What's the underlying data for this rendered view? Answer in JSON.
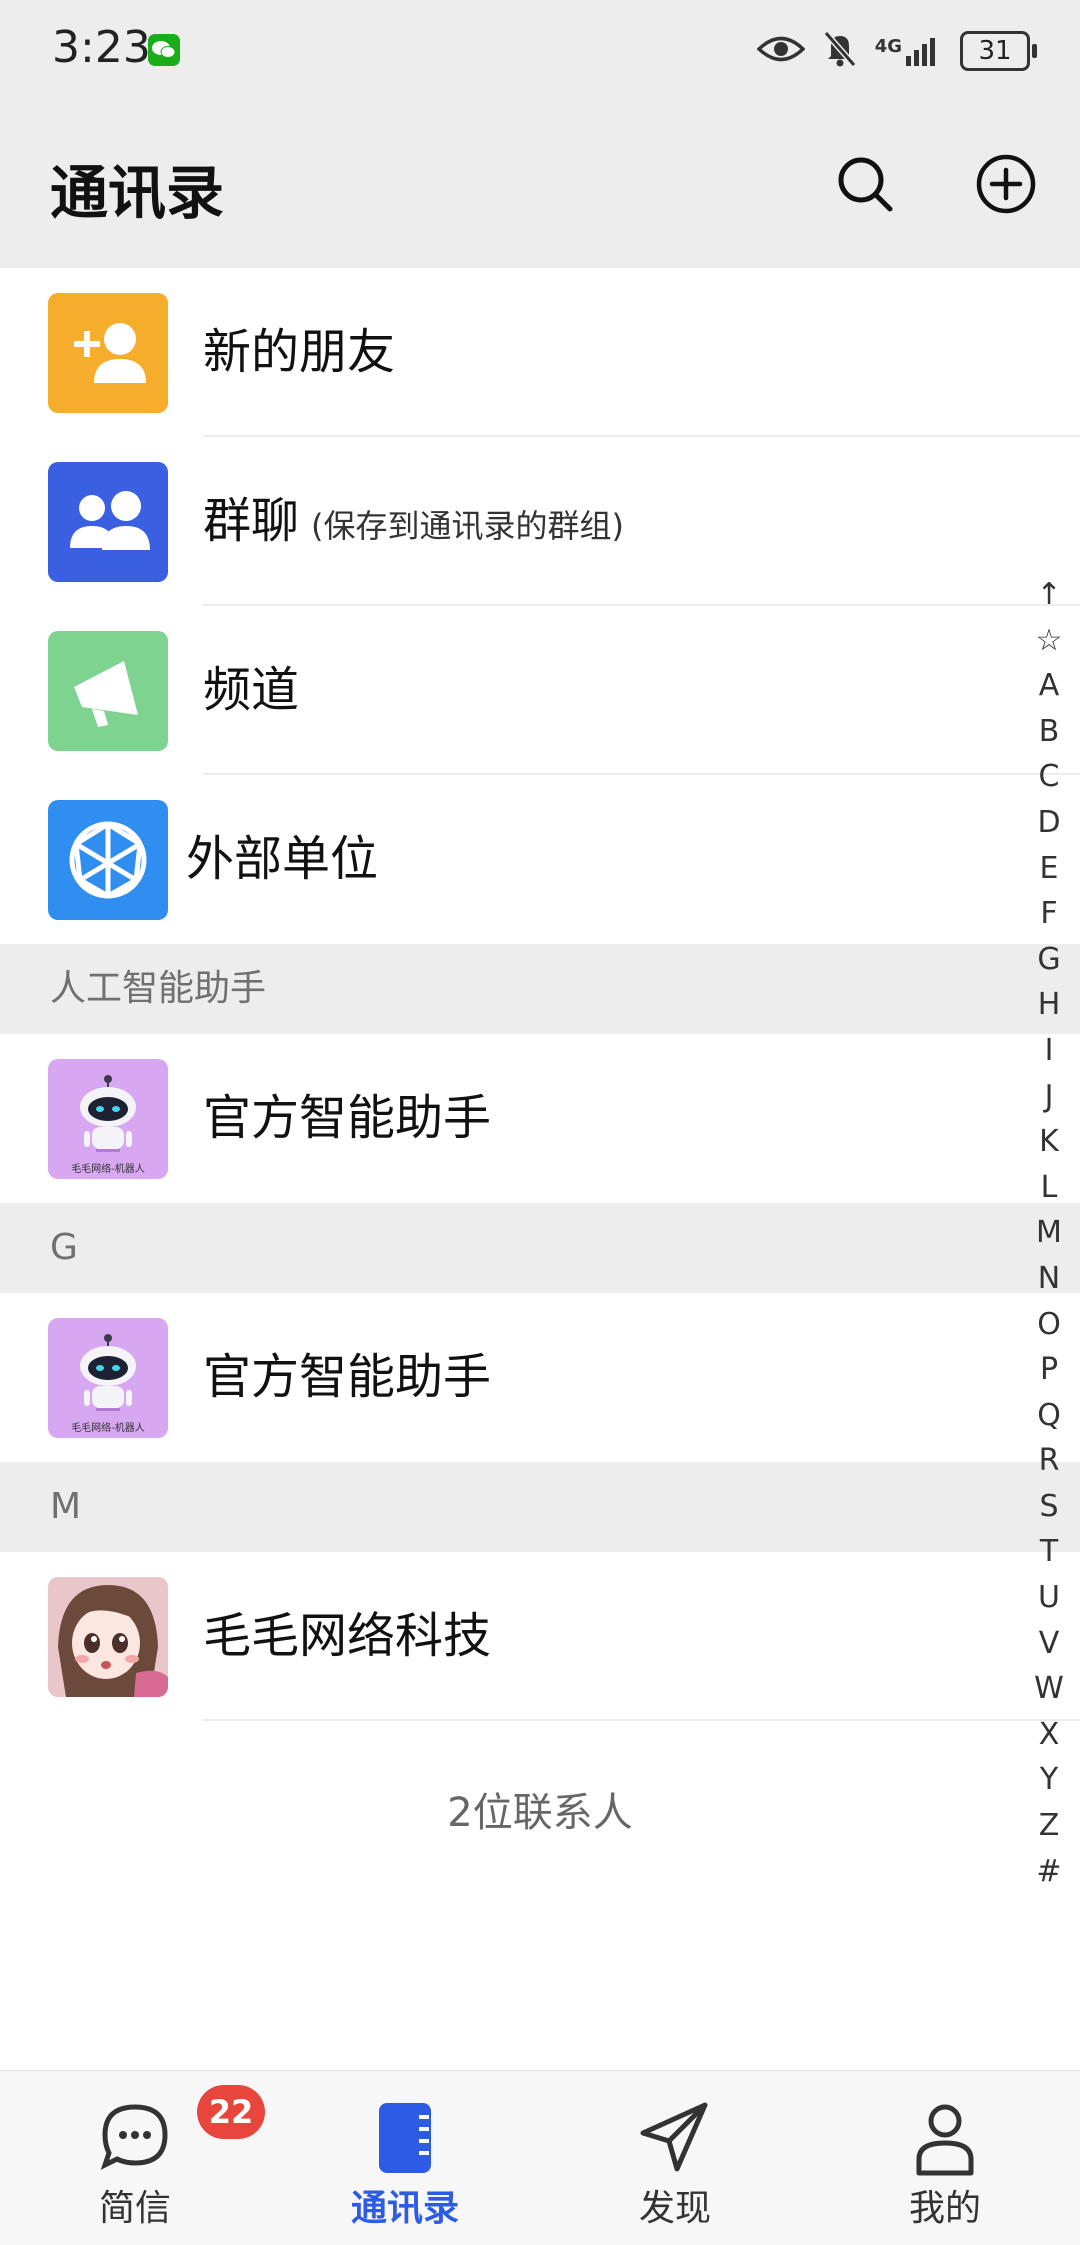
{
  "status_bar": {
    "time": "3:23",
    "network": "4G",
    "battery": "31",
    "icons": [
      "wechat-icon",
      "eye-icon",
      "bell-off-icon",
      "signal-icon",
      "battery-icon"
    ]
  },
  "header": {
    "title": "通讯录",
    "icons": [
      "search-icon",
      "add-circle-icon"
    ]
  },
  "top_entries": [
    {
      "label": "新的朋友",
      "icon": "add-friend-icon",
      "color": "#f6ad2b"
    },
    {
      "label": "群聊",
      "sublabel": "(保存到通讯录的群组)",
      "icon": "group-icon",
      "color": "#3a5fe0"
    },
    {
      "label": "频道",
      "icon": "megaphone-icon",
      "color": "#7dd38f"
    },
    {
      "label": "外部单位",
      "icon": "network-globe-icon",
      "color": "#2f8ef0"
    }
  ],
  "sections": [
    {
      "title": "人工智能助手",
      "contacts": [
        {
          "name": "官方智能助手",
          "avatar": "robot-avatar",
          "avatar_caption": "毛毛网络-机器人"
        }
      ]
    },
    {
      "title": "G",
      "contacts": [
        {
          "name": "官方智能助手",
          "avatar": "robot-avatar",
          "avatar_caption": "毛毛网络-机器人"
        }
      ]
    },
    {
      "title": "M",
      "contacts": [
        {
          "name": "毛毛网络科技",
          "avatar": "anime-girl-avatar"
        }
      ]
    }
  ],
  "contact_count": "2位联系人",
  "index_bar": [
    "↑",
    "☆",
    "A",
    "B",
    "C",
    "D",
    "E",
    "F",
    "G",
    "H",
    "I",
    "J",
    "K",
    "L",
    "M",
    "N",
    "O",
    "P",
    "Q",
    "R",
    "S",
    "T",
    "U",
    "V",
    "W",
    "X",
    "Y",
    "Z",
    "#"
  ],
  "bottom_nav": [
    {
      "label": "简信",
      "icon": "chat-bubble-icon",
      "badge": "22",
      "active": false
    },
    {
      "label": "通讯录",
      "icon": "contacts-book-icon",
      "active": true
    },
    {
      "label": "发现",
      "icon": "paper-plane-icon",
      "active": false
    },
    {
      "label": "我的",
      "icon": "person-icon",
      "active": false
    }
  ],
  "colors": {
    "accent": "#2d5be3",
    "badge": "#e8463d",
    "section_bg": "#ededed"
  }
}
